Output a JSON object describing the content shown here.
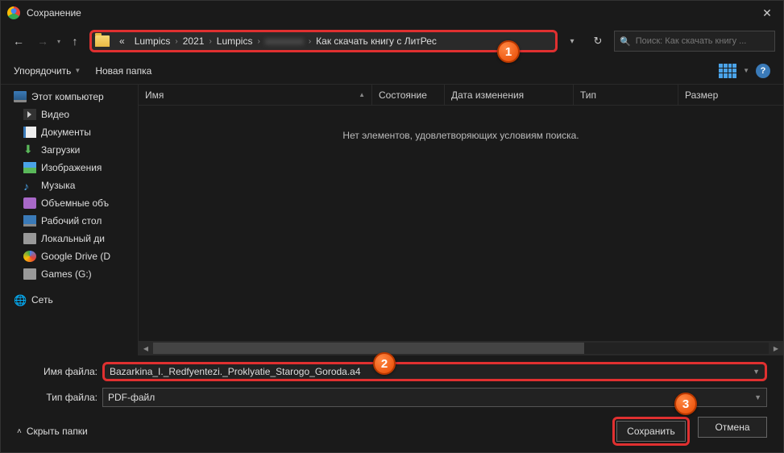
{
  "title": "Сохранение",
  "breadcrumb": {
    "prefix": "«",
    "parts": [
      "Lumpics",
      "2021",
      "Lumpics",
      "",
      "Как скачать книгу с ЛитРес"
    ]
  },
  "search": {
    "placeholder": "Поиск: Как скачать книгу ..."
  },
  "toolbar": {
    "organize": "Упорядочить",
    "new_folder": "Новая папка"
  },
  "columns": {
    "name": "Имя",
    "state": "Состояние",
    "modified": "Дата изменения",
    "type": "Тип",
    "size": "Размер"
  },
  "empty_msg": "Нет элементов, удовлетворяющих условиям поиска.",
  "sidebar": {
    "root": "Этот компьютер",
    "items": [
      "Видео",
      "Документы",
      "Загрузки",
      "Изображения",
      "Музыка",
      "Объемные объ",
      "Рабочий стол",
      "Локальный ди",
      "Google Drive (D",
      "Games (G:)"
    ],
    "network": "Сеть"
  },
  "filename": {
    "label": "Имя файла:",
    "value": "Bazarkina_I._Redfyentezi._Proklyatie_Starogo_Goroda.a4"
  },
  "filetype": {
    "label": "Тип файла:",
    "value": "PDF-файл"
  },
  "hide_folders": "Скрыть папки",
  "buttons": {
    "save": "Сохранить",
    "cancel": "Отмена"
  },
  "callouts": {
    "c1": "1",
    "c2": "2",
    "c3": "3"
  }
}
